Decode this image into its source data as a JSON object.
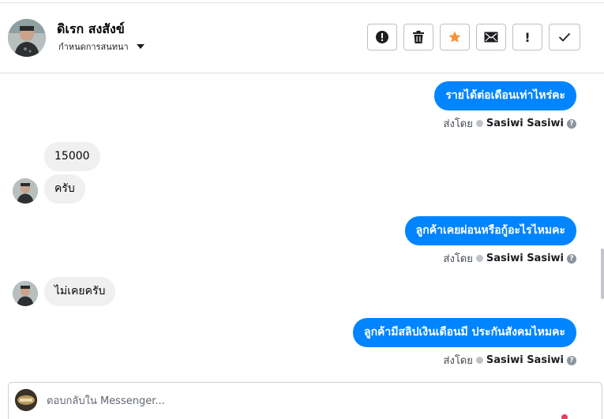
{
  "header": {
    "contact_name": "ดิเรก สงสังข์",
    "assign_label": "กำหนดการสนทนา",
    "actions": [
      {
        "name": "spam-button",
        "icon": "exclamation-circle-icon"
      },
      {
        "name": "delete-button",
        "icon": "trash-icon"
      },
      {
        "name": "star-button",
        "icon": "star-icon",
        "color": "#f7923b"
      },
      {
        "name": "unread-button",
        "icon": "envelope-icon"
      },
      {
        "name": "follow-up-button",
        "icon": "exclamation-icon",
        "label": "!"
      },
      {
        "name": "done-button",
        "icon": "check-icon"
      }
    ]
  },
  "messages": [
    {
      "dir": "out",
      "text": "รายได้ต่อเดือนเท่าไหร่คะ"
    },
    {
      "dir": "sent_by",
      "label": "ส่งโดย",
      "sender": "Sasiwi Sasiwi"
    },
    {
      "dir": "in",
      "text": "15000"
    },
    {
      "dir": "in",
      "text": "ครับ"
    },
    {
      "dir": "out",
      "text": "ลูกค้าเคยผ่อนหรือกู้อะไรไหมคะ"
    },
    {
      "dir": "sent_by",
      "label": "ส่งโดย",
      "sender": "Sasiwi Sasiwi"
    },
    {
      "dir": "in",
      "text": "ไม่เคยครับ"
    },
    {
      "dir": "out",
      "text": "ลูกค้ามีสลิปเงินเดือนมี ประกันสังคมไหมคะ"
    },
    {
      "dir": "sent_by",
      "label": "ส่งโดย",
      "sender": "Sasiwi Sasiwi"
    }
  ],
  "reply": {
    "placeholder": "ตอบกลับใน Messenger..."
  },
  "colors": {
    "outgoing_bubble": "#0084ff",
    "incoming_bubble": "#f0f0f0",
    "star": "#f7923b"
  }
}
